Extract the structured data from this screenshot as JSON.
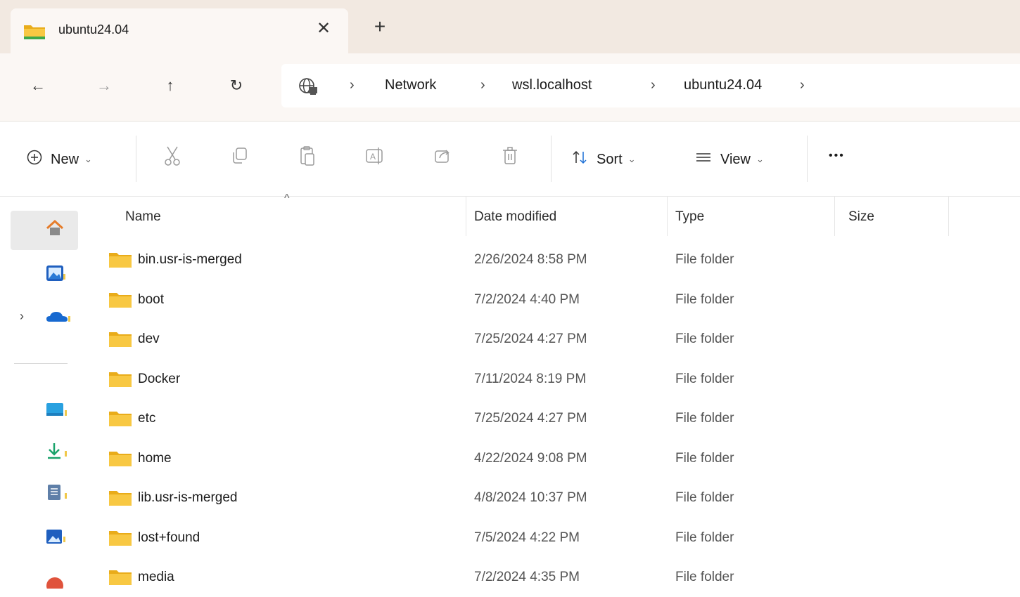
{
  "tab": {
    "title": "ubuntu24.04",
    "close_glyph": "✕",
    "new_glyph": "+"
  },
  "nav": {
    "back_glyph": "←",
    "forward_glyph": "→",
    "up_glyph": "↑",
    "refresh_glyph": "↻"
  },
  "breadcrumb": {
    "items": [
      "Network",
      "wsl.localhost",
      "ubuntu24.04"
    ],
    "separator": "›"
  },
  "toolbar": {
    "new_label": "New",
    "sort_label": "Sort",
    "view_label": "View",
    "more_glyph": "•••",
    "chevron": "⌄"
  },
  "columns": {
    "name": "Name",
    "date": "Date modified",
    "type": "Type",
    "size": "Size"
  },
  "rows": [
    {
      "name": "bin.usr-is-merged",
      "date": "2/26/2024 8:58 PM",
      "type": "File folder",
      "size": ""
    },
    {
      "name": "boot",
      "date": "7/2/2024 4:40 PM",
      "type": "File folder",
      "size": ""
    },
    {
      "name": "dev",
      "date": "7/25/2024 4:27 PM",
      "type": "File folder",
      "size": ""
    },
    {
      "name": "Docker",
      "date": "7/11/2024 8:19 PM",
      "type": "File folder",
      "size": ""
    },
    {
      "name": "etc",
      "date": "7/25/2024 4:27 PM",
      "type": "File folder",
      "size": ""
    },
    {
      "name": "home",
      "date": "4/22/2024 9:08 PM",
      "type": "File folder",
      "size": ""
    },
    {
      "name": "lib.usr-is-merged",
      "date": "4/8/2024 10:37 PM",
      "type": "File folder",
      "size": ""
    },
    {
      "name": "lost+found",
      "date": "7/5/2024 4:22 PM",
      "type": "File folder",
      "size": ""
    },
    {
      "name": "media",
      "date": "7/2/2024 4:35 PM",
      "type": "File folder",
      "size": ""
    }
  ],
  "colors": {
    "folder": "#f8c843",
    "folder_dark": "#e9ac1a",
    "tab_strip": "#f2e9e1",
    "nav_bg": "#fbf7f4"
  }
}
